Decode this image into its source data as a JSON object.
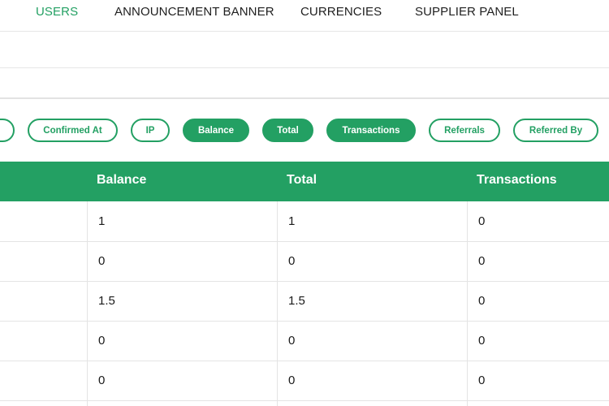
{
  "nav": {
    "items": [
      {
        "label": "USERS",
        "active": true
      },
      {
        "label": "ANNOUNCEMENT BANNER",
        "active": false
      },
      {
        "label": "CURRENCIES",
        "active": false
      },
      {
        "label": "SUPPLIER PANEL",
        "active": false
      }
    ]
  },
  "column_toggles": [
    {
      "label": "",
      "selected": false
    },
    {
      "label": "Confirmed At",
      "selected": false
    },
    {
      "label": "IP",
      "selected": false
    },
    {
      "label": "Balance",
      "selected": true
    },
    {
      "label": "Total",
      "selected": true
    },
    {
      "label": "Transactions",
      "selected": true
    },
    {
      "label": "Referrals",
      "selected": false
    },
    {
      "label": "Referred By",
      "selected": false
    }
  ],
  "table": {
    "headers": [
      "Balance",
      "Total",
      "Transactions"
    ],
    "rows": [
      [
        "1",
        "1",
        "0"
      ],
      [
        "0",
        "0",
        "0"
      ],
      [
        "1.5",
        "1.5",
        "0"
      ],
      [
        "0",
        "0",
        "0"
      ],
      [
        "0",
        "0",
        "0"
      ]
    ]
  },
  "colors": {
    "accent": "#23a063",
    "text": "#1f1f1f",
    "divider": "#e4e4e4"
  }
}
